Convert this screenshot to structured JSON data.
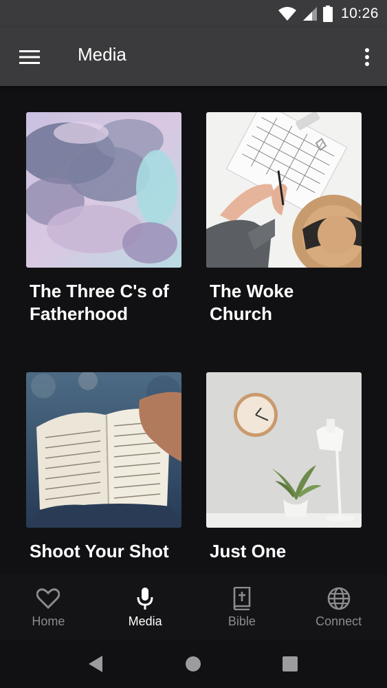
{
  "status_bar": {
    "time": "10:26",
    "icons": [
      "wifi-icon",
      "signal-icon",
      "battery-icon"
    ]
  },
  "app_bar": {
    "title": "Media",
    "menu_icon": "hamburger-menu-icon",
    "overflow_icon": "more-vert-icon"
  },
  "media": {
    "items": [
      {
        "title": "The Three C's of Fatherhood",
        "image": "cloudy pastel sky"
      },
      {
        "title": "The Woke Church",
        "image": "hands writing in notebook with straw hat"
      },
      {
        "title": "Shoot Your Shot",
        "image": "hand holding open bible"
      },
      {
        "title": "Just One",
        "image": "wall clock, plant and desk lamp"
      }
    ]
  },
  "bottom_nav": {
    "items": [
      {
        "label": "Home",
        "icon": "heart-icon",
        "active": false
      },
      {
        "label": "Media",
        "icon": "microphone-icon",
        "active": true
      },
      {
        "label": "Bible",
        "icon": "bible-icon",
        "active": false
      },
      {
        "label": "Connect",
        "icon": "globe-icon",
        "active": false
      }
    ]
  },
  "system_nav": {
    "icons": [
      "back-icon",
      "home-icon",
      "recents-icon"
    ]
  },
  "colors": {
    "app_bar": "#3b3b3d",
    "background": "#111113",
    "active_label": "#ffffff",
    "inactive_label": "#8c8c90"
  }
}
